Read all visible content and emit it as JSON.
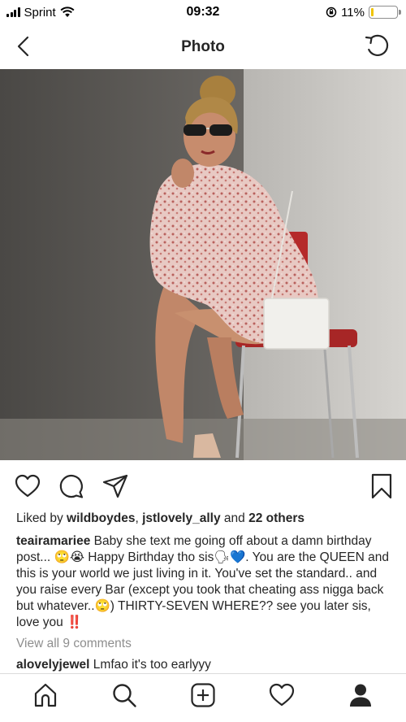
{
  "status_bar": {
    "carrier": "Sprint",
    "time": "09:32",
    "battery_percent": "11%",
    "battery_level": 0.11,
    "icons": [
      "signal-icon",
      "wifi-icon",
      "orientation-lock-icon",
      "battery-icon"
    ]
  },
  "nav": {
    "title": "Photo",
    "back_icon": "chevron-left-icon",
    "refresh_icon": "refresh-icon"
  },
  "actions": {
    "icons": [
      "heart-icon",
      "comment-icon",
      "share-icon",
      "bookmark-icon"
    ]
  },
  "likes": {
    "prefix": "Liked by ",
    "user1": "wildboydes",
    "separator": ", ",
    "user2": "jstlovely_ally",
    "suffix": " and ",
    "others": "22 others"
  },
  "caption": {
    "username": "teairamariee",
    "text": "Baby she text me going off about a damn birthday post... 🙄😭 Happy Birthday tho sis🗣💙. You are the QUEEN and this is your world we just living in it. You've set the standard.. and you raise every Bar (except you took that cheating ass nigga back but whatever..🙄) THIRTY-SEVEN WHERE?? see you later sis, love you ‼️"
  },
  "view_all": "View all 9 comments",
  "comment": {
    "username": "alovelyjewel",
    "text": "Lmfao it's too earlyyy"
  },
  "tab_bar": {
    "icons": [
      "home-icon",
      "search-icon",
      "new-post-icon",
      "activity-heart-icon",
      "profile-icon"
    ]
  }
}
